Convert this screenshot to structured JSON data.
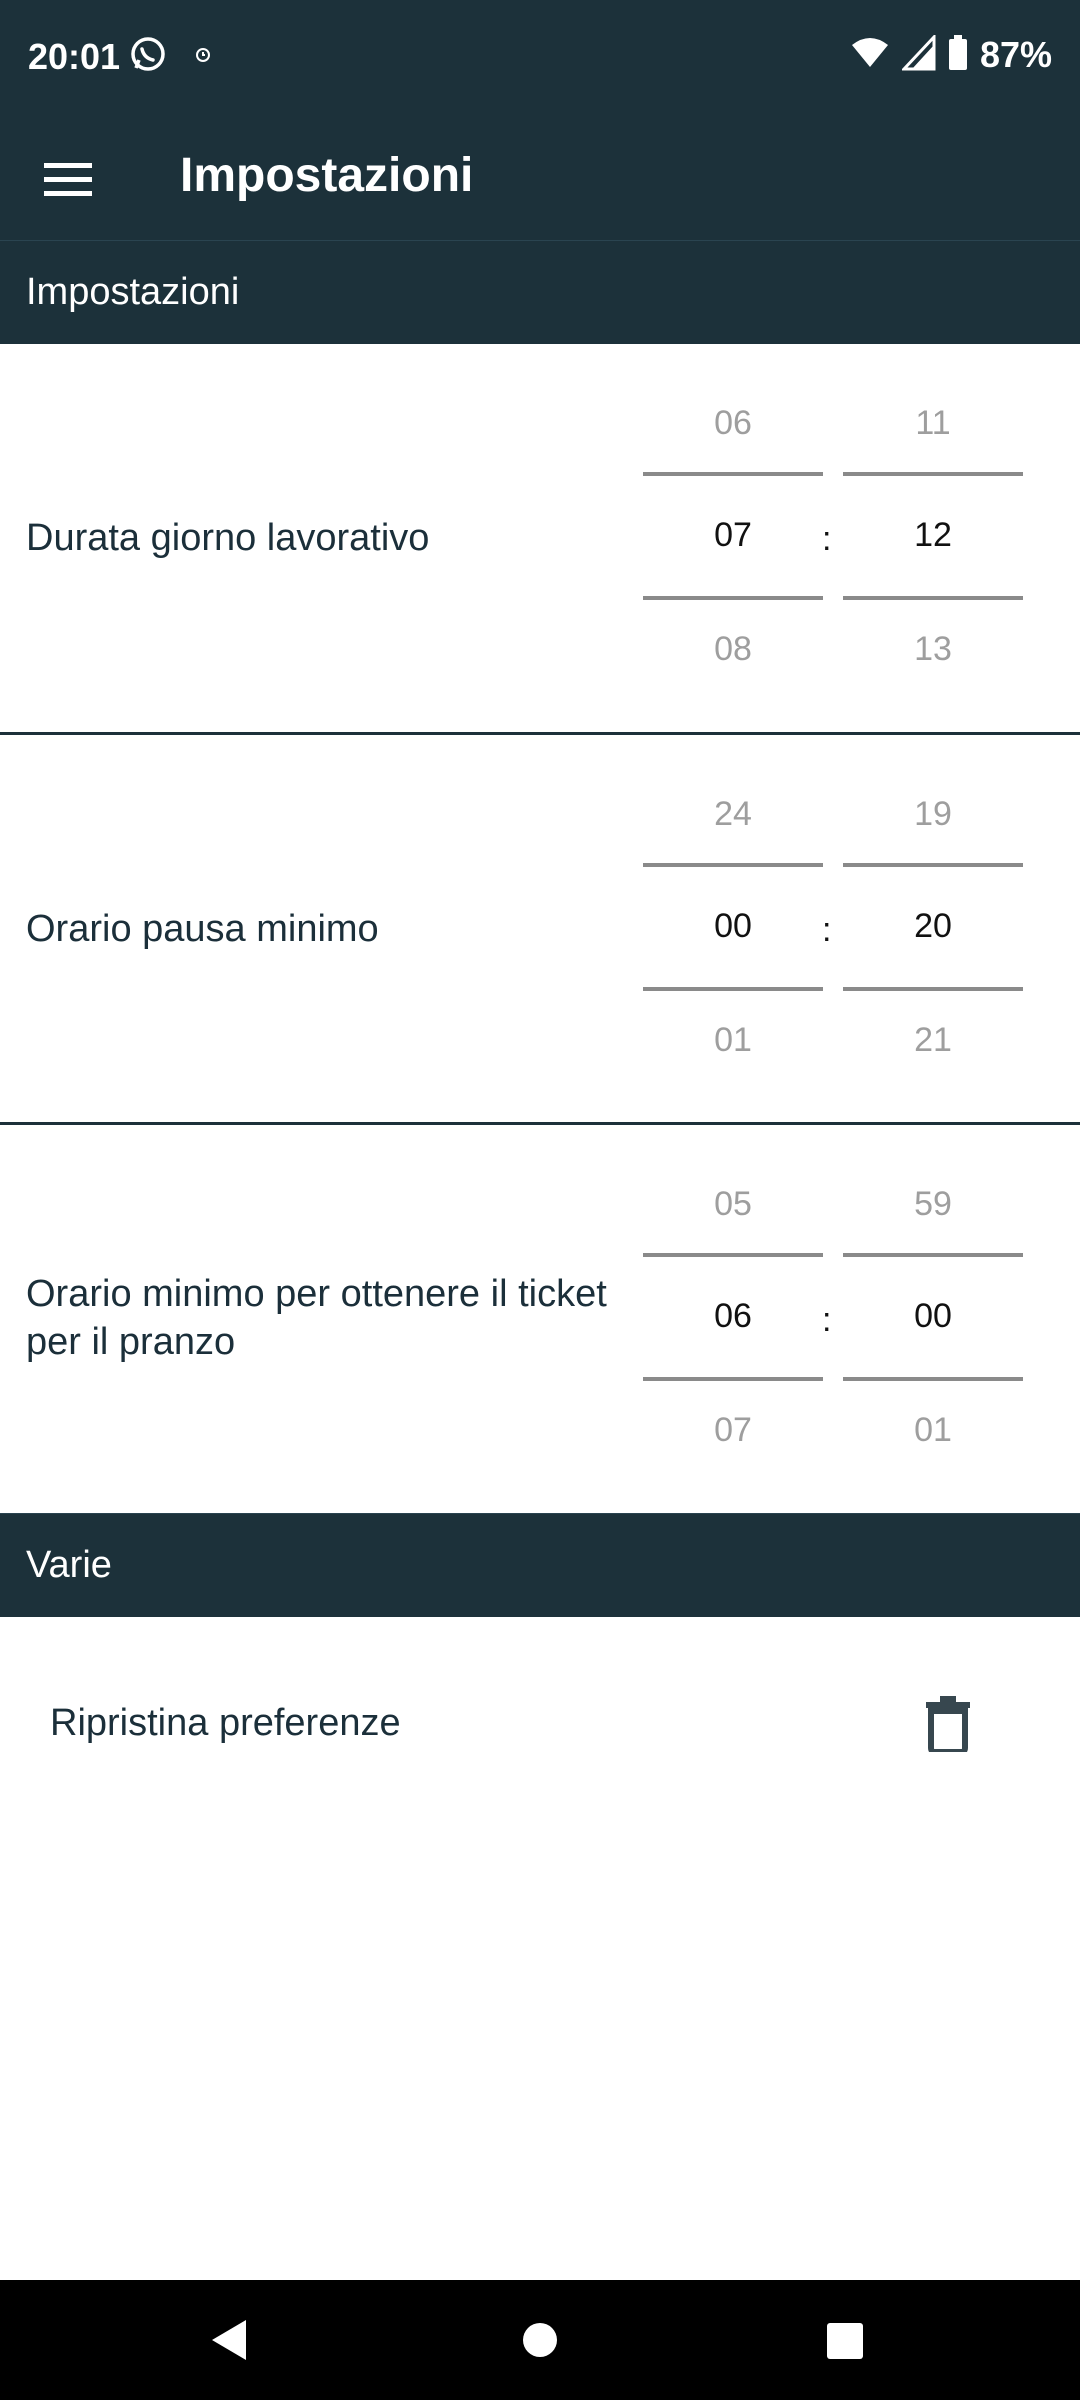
{
  "status_bar": {
    "time": "20:01",
    "battery": "87%",
    "icons": [
      "whatsapp-icon",
      "alarm-icon",
      "wifi-icon",
      "signal-icon",
      "battery-icon"
    ]
  },
  "app_bar": {
    "title": "Impostazioni",
    "menu_icon": "hamburger-menu-icon"
  },
  "sections": {
    "settings_header": "Impostazioni",
    "misc_header": "Varie"
  },
  "rows": [
    {
      "label": "Durata giorno lavorativo",
      "hours": {
        "prev": "06",
        "current": "07",
        "next": "08"
      },
      "minutes": {
        "prev": "11",
        "current": "12",
        "next": "13"
      },
      "separator": ":"
    },
    {
      "label": "Orario pausa minimo",
      "hours": {
        "prev": "24",
        "current": "00",
        "next": "01"
      },
      "minutes": {
        "prev": "19",
        "current": "20",
        "next": "21"
      },
      "separator": ":"
    },
    {
      "label": "Orario minimo per ottenere il ticket per il pranzo",
      "hours": {
        "prev": "05",
        "current": "06",
        "next": "07"
      },
      "minutes": {
        "prev": "59",
        "current": "00",
        "next": "01"
      },
      "separator": ":"
    }
  ],
  "misc": {
    "reset_label": "Ripristina preferenze",
    "reset_icon": "trash-icon"
  },
  "colors": {
    "primary": "#1c313a",
    "text": "#1b2f3a",
    "muted": "#9e9e9e"
  }
}
